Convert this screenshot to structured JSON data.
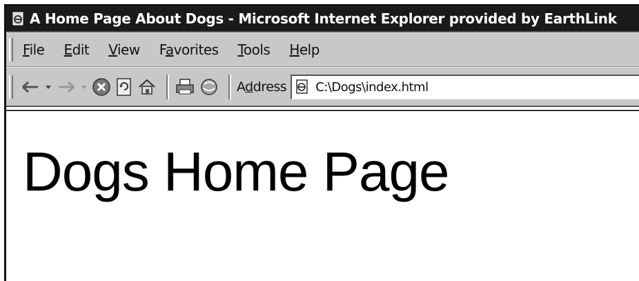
{
  "window": {
    "title": "A Home Page About Dogs - Microsoft Internet Explorer provided by EarthLink",
    "icon": "ie-page-icon"
  },
  "menubar": {
    "items": [
      {
        "label": "File",
        "accel": "F"
      },
      {
        "label": "Edit",
        "accel": "E"
      },
      {
        "label": "View",
        "accel": "V"
      },
      {
        "label": "Favorites",
        "accel": "a"
      },
      {
        "label": "Tools",
        "accel": "T"
      },
      {
        "label": "Help",
        "accel": "H"
      }
    ]
  },
  "toolbar": {
    "buttons": [
      "back-icon",
      "back-dropdown-icon",
      "forward-icon",
      "forward-dropdown-icon",
      "stop-icon",
      "refresh-icon",
      "home-icon",
      "print-icon",
      "media-icon"
    ],
    "address_label": "Address",
    "address_value": "C:\\Dogs\\index.html"
  },
  "page": {
    "heading": "Dogs Home Page"
  }
}
